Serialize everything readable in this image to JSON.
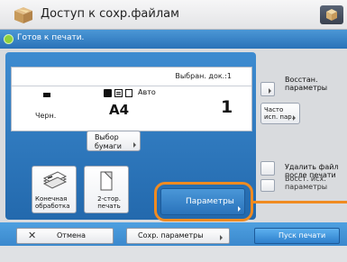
{
  "title": "Доступ к сохр.файлам",
  "status": "Готов к печати.",
  "summary": {
    "selected_label": "Выбран. док.:1",
    "color_label": "Черн.",
    "tray_label": "Авто",
    "paper_size": "A4",
    "copies": "1"
  },
  "buttons": {
    "paper_select": "Выбор бумаги",
    "finishing": "Конечная обработка",
    "duplex": "2-стор. печать",
    "parameters": "Параметры",
    "restore": "Восстан. параметры",
    "frequent": "Часто исп. пар.",
    "delete_after_print": "Удалить файл после печати",
    "recall": "Восст. исх. параметры",
    "cancel": "Отмена",
    "save_params": "Сохр. параметры",
    "start_print": "Пуск печати"
  },
  "colors": {
    "accent_blue": "#2f7ac2",
    "highlight_orange": "#f08b21"
  }
}
